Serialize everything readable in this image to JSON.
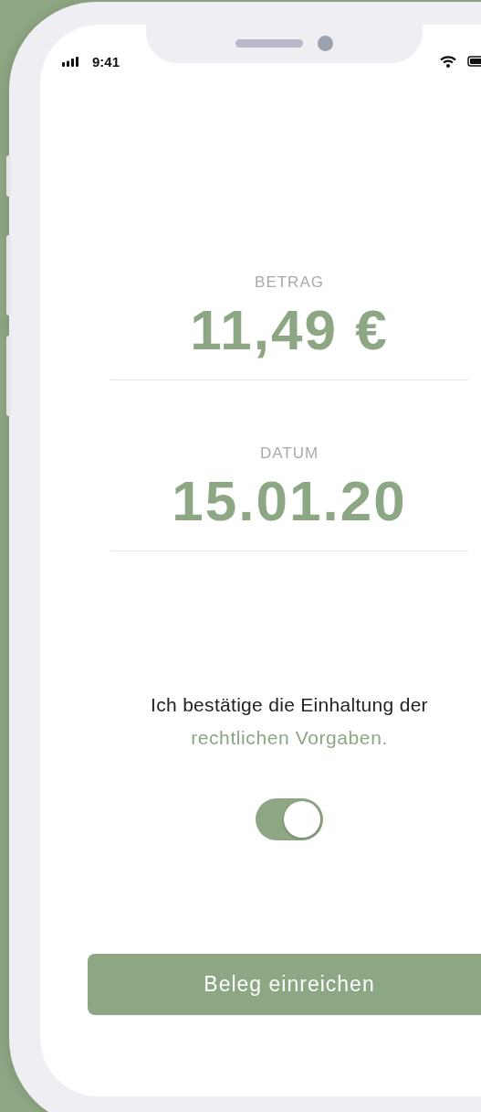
{
  "status_bar": {
    "time": "9:41"
  },
  "fields": [
    {
      "label": "BETRAG",
      "value": "11,49 €"
    },
    {
      "label": "DATUM",
      "value": "15.01.20"
    }
  ],
  "consent": {
    "text": "Ich bestätige die Einhaltung der",
    "link": "rechtlichen Vorgaben.",
    "on": true
  },
  "submit_button": "Beleg einreichen"
}
